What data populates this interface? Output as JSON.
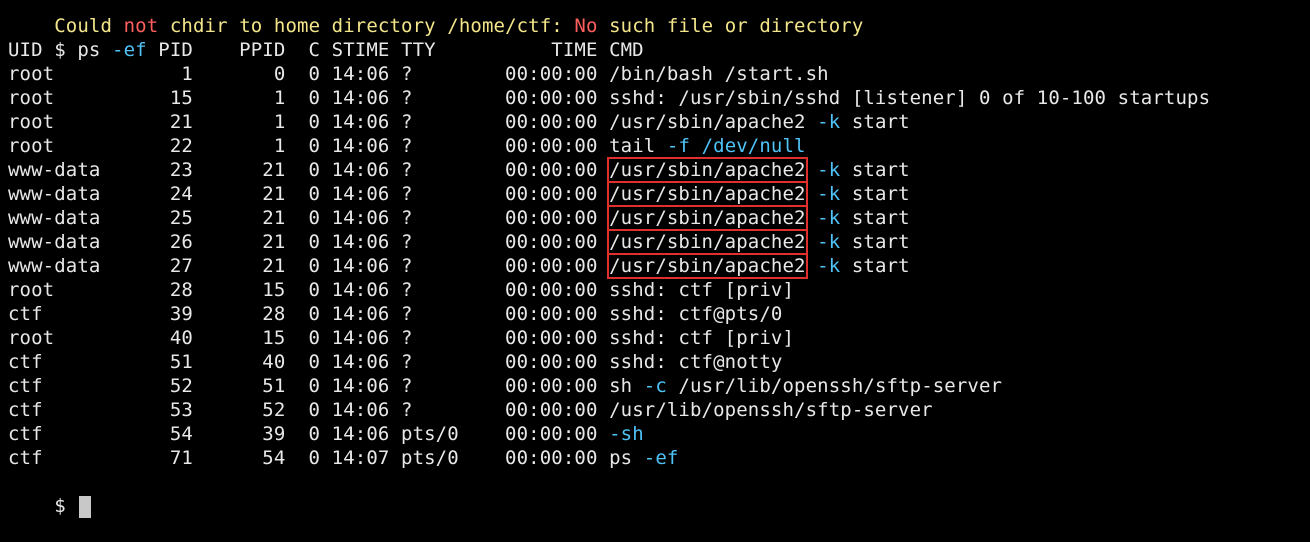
{
  "banner": {
    "part1": "Could ",
    "part2": "not",
    "part3": " chdir to home directory /home/ctf: ",
    "part4": "No",
    "part5": " such file or directory"
  },
  "command": {
    "prompt": "$ ",
    "cmd": "ps",
    "flag": " -ef"
  },
  "header": "UID          PID    PPID  C STIME TTY          TIME CMD",
  "rows": [
    {
      "pre": "root           1       0  0 14:06 ?        00:00:00 ",
      "cmd": "/bin/bash /start.sh"
    },
    {
      "pre": "root          15       1  0 14:06 ?        00:00:00 ",
      "cmd": "sshd: /usr/sbin/sshd [listener] 0 of 10-100 startups"
    },
    {
      "pre": "root          21       1  0 14:06 ?        00:00:00 ",
      "cmd": "/usr/sbin/apache2",
      "flag": " -k",
      "arg": " start"
    },
    {
      "pre": "root          22       1  0 14:06 ?        00:00:00 ",
      "cmd": "tail",
      "flag": " -f",
      "arg": " /dev/null"
    },
    {
      "pre": "www-data      23      21  0 14:06 ?        00:00:00 ",
      "cmd": "/usr/sbin/apache2",
      "flag": " -k",
      "arg": " start"
    },
    {
      "pre": "www-data      24      21  0 14:06 ?        00:00:00 ",
      "cmd": "/usr/sbin/apache2",
      "flag": " -k",
      "arg": " start"
    },
    {
      "pre": "www-data      25      21  0 14:06 ?        00:00:00 ",
      "cmd": "/usr/sbin/apache2",
      "flag": " -k",
      "arg": " start"
    },
    {
      "pre": "www-data      26      21  0 14:06 ?        00:00:00 ",
      "cmd": "/usr/sbin/apache2",
      "flag": " -k",
      "arg": " start"
    },
    {
      "pre": "www-data      27      21  0 14:06 ?        00:00:00 ",
      "cmd": "/usr/sbin/apache2",
      "flag": " -k",
      "arg": " start"
    },
    {
      "pre": "root          28      15  0 14:06 ?        00:00:00 ",
      "cmd": "sshd: ctf [priv]"
    },
    {
      "pre": "ctf           39      28  0 14:06 ?        00:00:00 ",
      "cmd": "sshd: ctf@pts/0"
    },
    {
      "pre": "root          40      15  0 14:06 ?        00:00:00 ",
      "cmd": "sshd: ctf [priv]"
    },
    {
      "pre": "ctf           51      40  0 14:06 ?        00:00:00 ",
      "cmd": "sshd: ctf@notty"
    },
    {
      "pre": "ctf           52      51  0 14:06 ?        00:00:00 ",
      "cmd": "sh",
      "flag": " -c",
      "arg": " /usr/lib/openssh/sftp-server"
    },
    {
      "pre": "ctf           53      52  0 14:06 ?        00:00:00 ",
      "cmd": "/usr/lib/openssh/sftp-server"
    },
    {
      "pre": "ctf           54      39  0 14:06 pts/0    00:00:00 ",
      "cmd": "",
      "flag": "-sh"
    },
    {
      "pre": "ctf           71      54  0 14:07 pts/0    00:00:00 ",
      "cmd": "ps",
      "flag": " -ef"
    }
  ],
  "final_prompt": "$ ",
  "colors": {
    "background": "#000000",
    "text": "#e8e8e8",
    "yellow": "#f3e58a",
    "red": "#ff5f5f",
    "cyan": "#4fc3f7",
    "highlight": "#e0302e"
  }
}
